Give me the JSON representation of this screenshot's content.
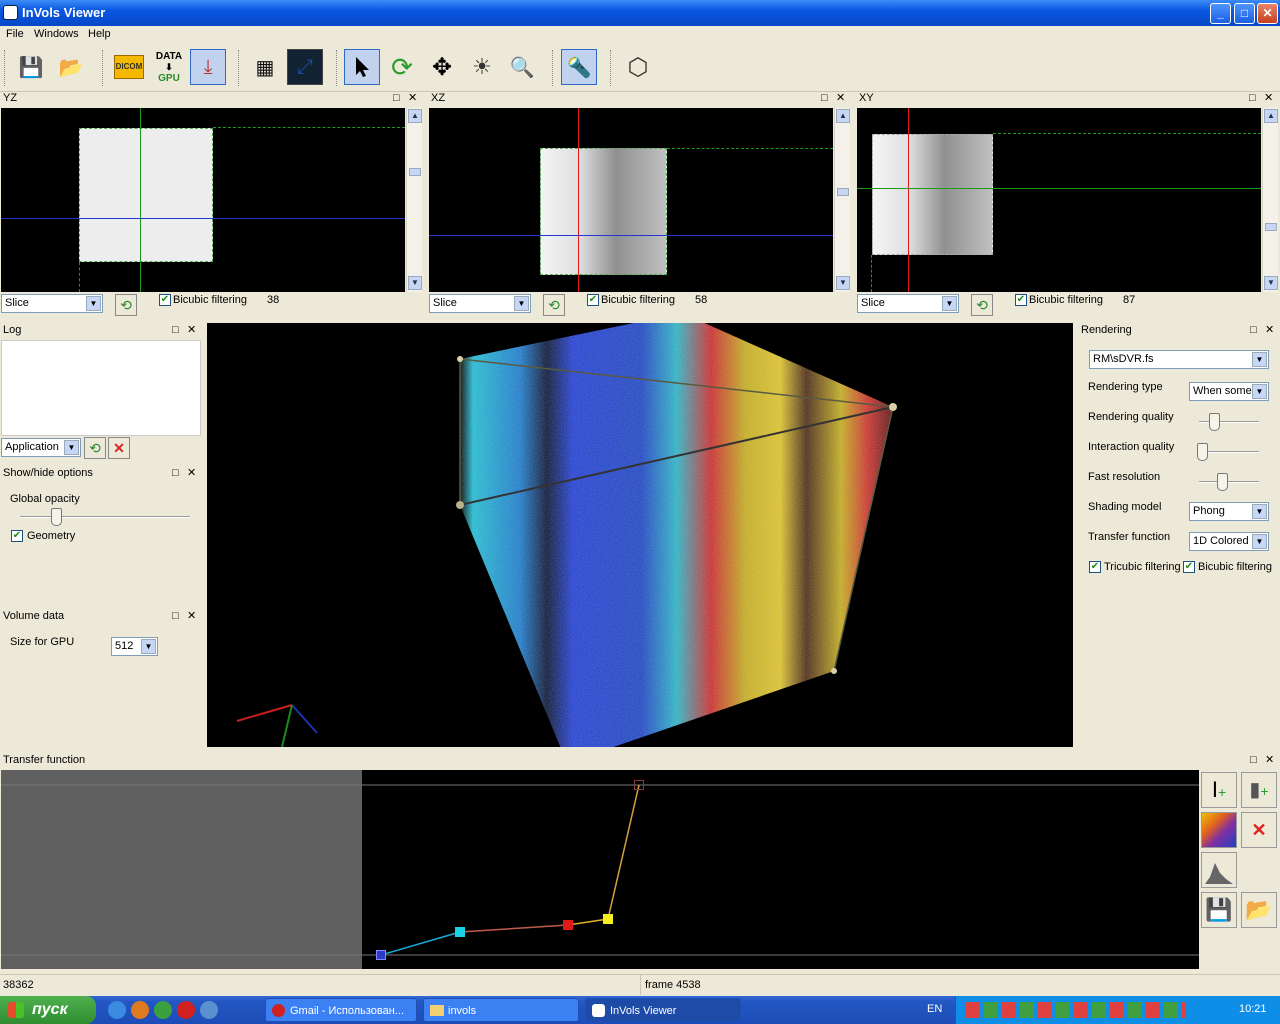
{
  "window": {
    "title": "InVols Viewer",
    "minimize": "_",
    "maximize": "□",
    "close": "✕"
  },
  "menu": [
    "File",
    "Windows",
    "Help"
  ],
  "toolbar": {
    "buttons": [
      "save-icon",
      "open-folder-icon",
      "dicom-icon",
      "data-gpu-icon",
      "export-icon",
      "layout-grid-icon",
      "fit-view-icon",
      "select-arrow-icon",
      "rotate-icon",
      "pan-icon",
      "light-icon",
      "zoom-icon",
      "flashlight-icon",
      "geometry-icon"
    ],
    "dicom_label": "DICOM",
    "data_label": "DATA",
    "gpu_label": "GPU",
    "glyphs": {
      "save": "💾",
      "open": "📂",
      "export": "⤓",
      "grid": "▦",
      "fit": "⤢",
      "arrow": "➤",
      "rotate": "⟳",
      "pan": "✥",
      "light": "☀",
      "zoom": "🔍",
      "flashlight": "🔦",
      "geometry": "⬡"
    }
  },
  "slices": [
    {
      "title": "YZ",
      "mode": "Slice",
      "bicubic_label": "Bicubic filtering",
      "value": "38"
    },
    {
      "title": "XZ",
      "mode": "Slice",
      "bicubic_label": "Bicubic filtering",
      "value": "58"
    },
    {
      "title": "XY",
      "mode": "Slice",
      "bicubic_label": "Bicubic filtering",
      "value": "87"
    }
  ],
  "pane_buttons": {
    "float": "□",
    "close": "✕"
  },
  "log": {
    "title": "Log",
    "filter": "Application",
    "refresh_glyph": "⟲",
    "clear_glyph": "✕"
  },
  "show_hide": {
    "title": "Show/hide options",
    "global_opacity_label": "Global opacity",
    "global_opacity": 0.2,
    "geometry_label": "Geometry",
    "geometry_checked": true
  },
  "volume_data": {
    "title": "Volume data",
    "size_label": "Size for GPU",
    "size_value": "512"
  },
  "rendering": {
    "title": "Rendering",
    "shader": "RM\\sDVR.fs",
    "rendering_type_label": "Rendering type",
    "rendering_type": "When some",
    "rendering_quality_label": "Rendering quality",
    "rendering_quality": 0.25,
    "interaction_quality_label": "Interaction quality",
    "interaction_quality": 0.05,
    "fast_resolution_label": "Fast resolution",
    "fast_resolution": 0.4,
    "shading_model_label": "Shading model",
    "shading_model": "Phong",
    "transfer_function_label": "Transfer function",
    "transfer_function": "1D Colored",
    "tricubic_label": "Tricubic filtering",
    "bicubic_label": "Bicubic filtering"
  },
  "transfer_function": {
    "title": "Transfer function",
    "colors": {
      "blue": "#2c3cc8",
      "cyan": "#19d3e6",
      "red": "#e01a1a",
      "yellow": "#f4ef1c",
      "top": "#8a3a3a"
    }
  },
  "status": {
    "left": "38362",
    "frame": "frame 4538"
  },
  "taskbar": {
    "start": "пуск",
    "tasks": [
      "Gmail - Использован...",
      "invols",
      "InVols Viewer"
    ],
    "lang": "EN",
    "clock": "10:21"
  }
}
